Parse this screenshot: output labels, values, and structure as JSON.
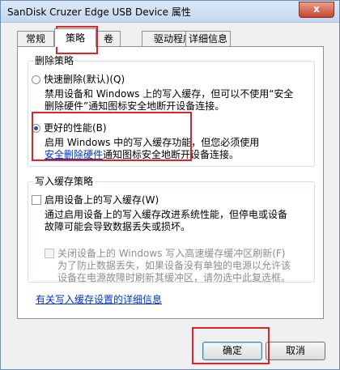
{
  "window": {
    "title": "SanDisk Cruzer Edge USB Device 属性",
    "close_glyph": "x"
  },
  "tabs": [
    "常规",
    "策略",
    "卷",
    "驱动程序",
    "详细信息"
  ],
  "removal_policy": {
    "title": "删除策略",
    "quick_removal": {
      "label": "快速删除(默认)(Q)",
      "desc_line1": "禁用设备和 Windows 上的写入缓存，但可以不使用“安全",
      "desc_line2": "删除硬件”通知图标安全地断开设备连接。"
    },
    "better_performance": {
      "label": "更好的性能(B)",
      "desc_line1": "启用 Windows 中的写入缓存功能，但您必须使用",
      "desc_link": "安全删除硬件",
      "desc_line2_rest": "通知图标安全地断开设备连接。"
    }
  },
  "write_cache_policy": {
    "title": "写入缓存策略",
    "enable_cache": {
      "label": "启用设备上的写入缓存(W)",
      "desc_line1": "通过启用设备上的写入缓存改进系统性能，但停电或设备",
      "desc_line2": "故障可能会导致数据丢失或损坏。"
    },
    "disable_flush": {
      "label": "关闭设备上的 Windows 写入高速缓存缓冲区刷新(F)",
      "desc_line1": "为了防止数据丢失，如果设备没有单独的电源以允许该",
      "desc_line2": "设备在电源故障时刷新其缓冲区，请勿选中此复选框。"
    }
  },
  "details_link": "有关写入缓存设置的详细信息",
  "buttons": {
    "ok": "确定",
    "cancel": "取消"
  }
}
